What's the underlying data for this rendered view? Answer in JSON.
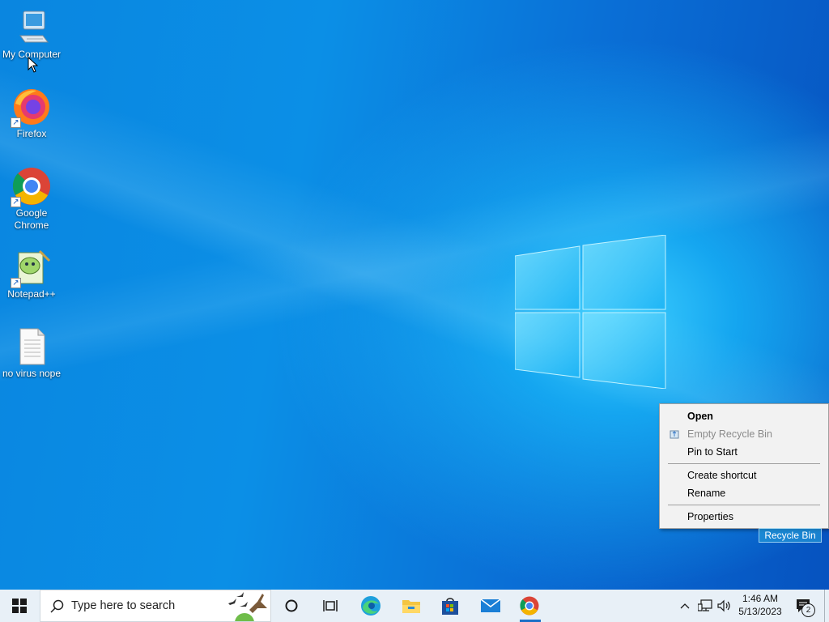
{
  "desktop": {
    "icons": [
      {
        "label": "My Computer",
        "icon": "computer-icon"
      },
      {
        "label": "Firefox",
        "icon": "firefox-icon"
      },
      {
        "label": "Google Chrome",
        "icon": "chrome-icon"
      },
      {
        "label": "Notepad++",
        "icon": "notepadpp-icon"
      },
      {
        "label": "no virus nope",
        "icon": "text-file-icon"
      }
    ],
    "recycle_bin_label": "Recycle Bin"
  },
  "context_menu": {
    "items": [
      {
        "label": "Open",
        "bold": true
      },
      {
        "label": "Empty Recycle Bin",
        "disabled": true,
        "icon": "recycle-bin-small-icon"
      },
      {
        "label": "Pin to Start"
      },
      {
        "label": "Create shortcut"
      },
      {
        "label": "Rename"
      },
      {
        "label": "Properties"
      }
    ]
  },
  "taskbar": {
    "search_placeholder": "Type here to search",
    "apps": [
      "cortana-icon",
      "task-view-icon",
      "edge-icon",
      "file-explorer-icon",
      "store-icon",
      "mail-icon",
      "chrome-icon"
    ],
    "clock_time": "1:46 AM",
    "clock_date": "5/13/2023",
    "notification_count": "2"
  },
  "colors": {
    "accent": "#0a78d7",
    "taskbar_bg": "#e8f0f7",
    "menu_bg": "#f2f2f2"
  }
}
